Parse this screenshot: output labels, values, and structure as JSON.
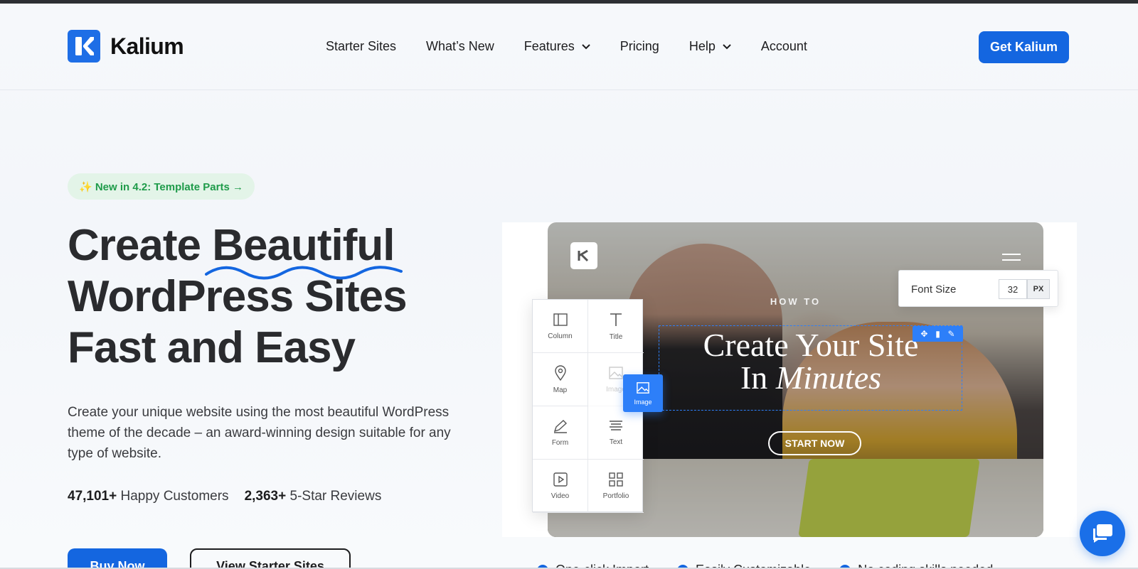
{
  "brand": {
    "name": "Kalium",
    "accent": "#1466e0",
    "badge_green": "#1f9b4a"
  },
  "nav": {
    "items": [
      {
        "label": "Starter Sites",
        "dropdown": false
      },
      {
        "label": "What’s New",
        "dropdown": false
      },
      {
        "label": "Features",
        "dropdown": true
      },
      {
        "label": "Pricing",
        "dropdown": false
      },
      {
        "label": "Help",
        "dropdown": true
      },
      {
        "label": "Account",
        "dropdown": false
      }
    ],
    "cta": "Get Kalium"
  },
  "hero": {
    "badge": "✨ New in 4.2: Template Parts →",
    "title_lines": [
      "Create Beautiful",
      "WordPress Sites",
      "Fast and Easy"
    ],
    "description": "Create your unique website using the most beautiful WordPress theme of the decade – an award-winning design suitable for any type of website.",
    "stats": [
      {
        "value": "47,101+",
        "label": "Happy Customers"
      },
      {
        "value": "2,363+",
        "label": "5-Star Reviews"
      }
    ],
    "buttons": {
      "primary": "Buy Now",
      "secondary": "View Starter Sites"
    }
  },
  "mockup": {
    "eyebrow": "HOW TO",
    "title_line1": "Create Your Site",
    "title_line2_prefix": "In ",
    "title_line2_italic": "Minutes",
    "button": "START NOW",
    "widgets": [
      {
        "label": "Column",
        "icon": "column-icon"
      },
      {
        "label": "Title",
        "icon": "title-icon"
      },
      {
        "label": "Map",
        "icon": "map-pin-icon"
      },
      {
        "label": "Image",
        "icon": "image-icon"
      },
      {
        "label": "Form",
        "icon": "form-icon"
      },
      {
        "label": "Text",
        "icon": "text-icon"
      },
      {
        "label": "Video",
        "icon": "video-icon"
      },
      {
        "label": "Portfolio",
        "icon": "portfolio-icon"
      }
    ],
    "drag_chip": "Image",
    "font_panel": {
      "label": "Font Size",
      "value": "32",
      "unit": "PX"
    }
  },
  "features": [
    "One-click Import",
    "Easily Customizable",
    "No coding skills needed"
  ]
}
